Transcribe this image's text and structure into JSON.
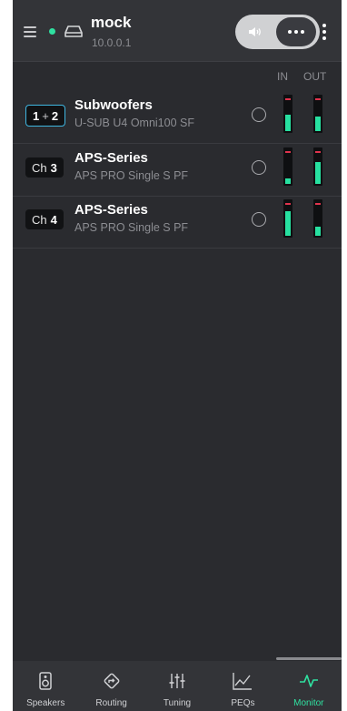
{
  "header": {
    "title": "mock",
    "ip": "10.0.0.1",
    "status_color": "#2fe0a0"
  },
  "columns": {
    "in": "IN",
    "out": "OUT"
  },
  "channels": [
    {
      "badge_prefix": "1",
      "badge_sep": "+",
      "badge_num": "2",
      "title": "Subwoofers",
      "subtitle": "U-SUB U4 Omni100 SF",
      "in_level": 0.55,
      "out_level": 0.5
    },
    {
      "badge_prefix": "Ch",
      "badge_num": "3",
      "title": "APS-Series",
      "subtitle": "APS PRO Single S PF",
      "in_level": 0.2,
      "out_level": 0.75
    },
    {
      "badge_prefix": "Ch",
      "badge_num": "4",
      "title": "APS-Series",
      "subtitle": "APS PRO Single S PF",
      "in_level": 0.85,
      "out_level": 0.3
    }
  ],
  "nav": {
    "items": [
      {
        "label": "Speakers",
        "icon": "speaker-icon"
      },
      {
        "label": "Routing",
        "icon": "routing-icon"
      },
      {
        "label": "Tuning",
        "icon": "tuning-sliders-icon"
      },
      {
        "label": "PEQs",
        "icon": "peq-graph-icon"
      },
      {
        "label": "Monitor",
        "icon": "monitor-pulse-icon"
      }
    ],
    "active": "Monitor",
    "accent": "#2fe0a0"
  }
}
